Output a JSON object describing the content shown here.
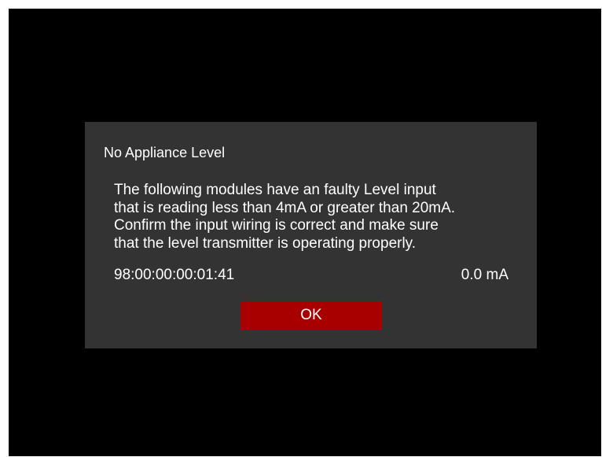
{
  "dialog": {
    "title": "No Appliance Level",
    "message_lines": [
      "The following modules have an faulty Level input",
      "that is reading less than 4mA or greater than 20mA.",
      "Confirm the input wiring is correct and make sure",
      "that the level transmitter is operating properly."
    ],
    "modules": [
      {
        "id": "98:00:00:00:01:41",
        "value": "0.0 mA"
      }
    ],
    "ok_label": "OK"
  },
  "colors": {
    "screen_background": "#000000",
    "dialog_background": "#333333",
    "text": "#ffffff",
    "button_background": "#a80000"
  }
}
